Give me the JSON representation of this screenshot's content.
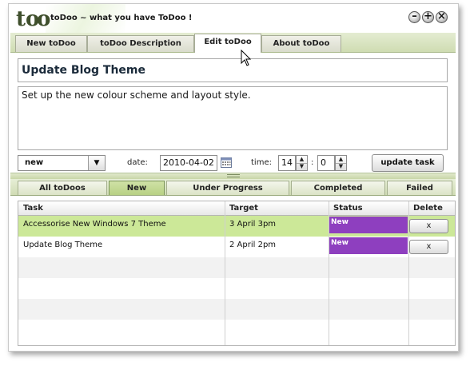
{
  "app": {
    "logo_text": "to​o",
    "title": "toDoo ~ what you have ToDoo !",
    "minimize_glyph": "–",
    "maximize_glyph": "+",
    "close_glyph": "×"
  },
  "tabs": [
    {
      "label": "New toDoo"
    },
    {
      "label": "toDoo Description"
    },
    {
      "label": "Edit toDoo"
    },
    {
      "label": "About toDoo"
    }
  ],
  "editor": {
    "task_title": "Update Blog Theme",
    "description": "Set up the new colour scheme and layout style."
  },
  "controls": {
    "status_value": "new",
    "date_label": "date:",
    "date_value": "2010-04-02",
    "time_label": "time:",
    "hour_value": "14",
    "colon": ":",
    "minute_value": "0",
    "update_label": "update task"
  },
  "filters": [
    {
      "label": "All toDoos"
    },
    {
      "label": "New"
    },
    {
      "label": "Under Progress"
    },
    {
      "label": "Completed"
    },
    {
      "label": "Failed"
    }
  ],
  "table": {
    "headers": [
      "Task",
      "Target",
      "Status",
      "Delete"
    ],
    "rows": [
      {
        "task": "Accessorise New Windows 7 Theme",
        "target": "3 April 3pm",
        "status": "New",
        "delete": "x"
      },
      {
        "task": "Update Blog Theme",
        "target": "2 April 2pm",
        "status": "New",
        "delete": "x"
      }
    ]
  },
  "colors": {
    "accent_green": "#cce898",
    "status_new": "#8e3fbf"
  }
}
